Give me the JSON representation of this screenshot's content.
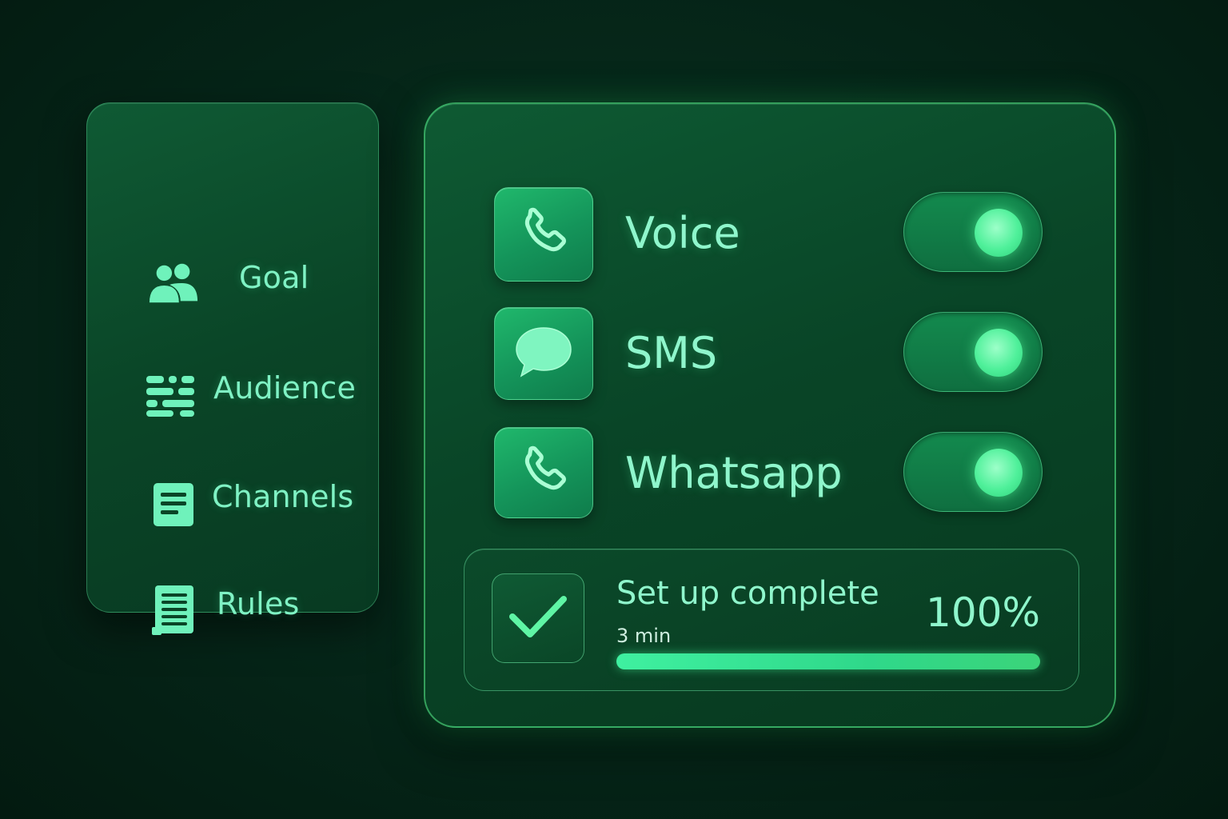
{
  "sidebar": {
    "items": [
      {
        "label": "Goal",
        "icon": "users-icon"
      },
      {
        "label": "Audience",
        "icon": "filter-lines-icon"
      },
      {
        "label": "Channels",
        "icon": "document-icon"
      },
      {
        "label": "Rules",
        "icon": "list-document-icon"
      }
    ]
  },
  "channels": [
    {
      "label": "Voice",
      "icon": "phone-icon",
      "enabled": true
    },
    {
      "label": "SMS",
      "icon": "chat-bubble-icon",
      "enabled": true
    },
    {
      "label": "Whatsapp",
      "icon": "phone-icon",
      "enabled": true
    }
  ],
  "completion": {
    "title": "Set up complete",
    "time": "3 min",
    "percent_label": "100%",
    "progress": 1.0,
    "icon": "checkmark-icon"
  },
  "colors": {
    "accent": "#4ff09a",
    "text": "#8ff6cc",
    "panel": "#0a4527",
    "background": "#031a10"
  }
}
